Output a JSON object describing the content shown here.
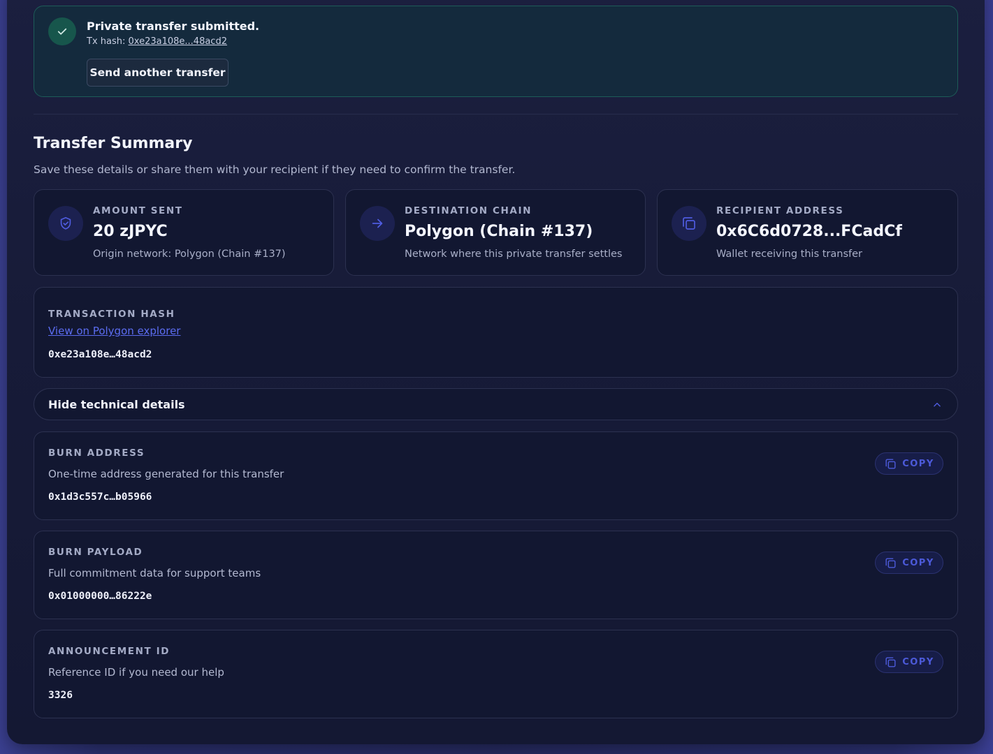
{
  "success": {
    "title": "Private transfer submitted.",
    "hash_prefix": "Tx hash:",
    "hash_short": "0xe23a108e...48acd2",
    "send_another": "Send another transfer"
  },
  "summary": {
    "title": "Transfer Summary",
    "description": "Save these details or share them with your recipient if they need to confirm the transfer.",
    "cards": [
      {
        "label": "AMOUNT SENT",
        "value": "20 zJPYC",
        "sub": "Origin network: Polygon (Chain #137)",
        "icon": "shield-check-icon"
      },
      {
        "label": "DESTINATION CHAIN",
        "value": "Polygon (Chain #137)",
        "sub": "Network where this private transfer settles",
        "icon": "arrow-right-icon"
      },
      {
        "label": "RECIPIENT ADDRESS",
        "value": "0x6C6d0728...FCadCf",
        "sub": "Wallet receiving this transfer",
        "icon": "copy-icon"
      }
    ]
  },
  "tx": {
    "label": "TRANSACTION HASH",
    "explorer_link": "View on Polygon explorer",
    "hash": "0xe23a108e…48acd2"
  },
  "toggle": {
    "label": "Hide technical details",
    "icon": "chevron-up-icon"
  },
  "technical": [
    {
      "label": "BURN ADDRESS",
      "sub": "One-time address generated for this transfer",
      "value": "0x1d3c557c…b05966",
      "copy": "COPY"
    },
    {
      "label": "BURN PAYLOAD",
      "sub": "Full commitment data for support teams",
      "value": "0x01000000…86222e",
      "copy": "COPY"
    },
    {
      "label": "ANNOUNCEMENT ID",
      "sub": "Reference ID if you need our help",
      "value": "3326",
      "copy": "COPY"
    }
  ],
  "colors": {
    "accent": "#5b6cf0",
    "success": "#17564c",
    "card_bg": "#121731"
  }
}
